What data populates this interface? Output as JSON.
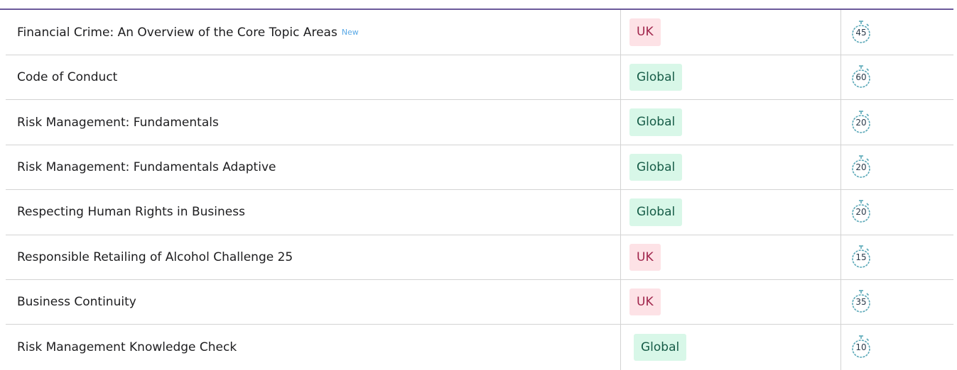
{
  "courses": [
    {
      "title": "Financial Crime: An Overview of the Core Topic Areas",
      "new_tag": "New",
      "region": "UK",
      "duration": "45"
    },
    {
      "title": "Code of Conduct",
      "new_tag": "",
      "region": "Global",
      "duration": "60"
    },
    {
      "title": "Risk Management: Fundamentals",
      "new_tag": "",
      "region": "Global",
      "duration": "20"
    },
    {
      "title": "Risk Management: Fundamentals Adaptive",
      "new_tag": "",
      "region": "Global",
      "duration": "20"
    },
    {
      "title": "Respecting Human Rights in Business",
      "new_tag": "",
      "region": "Global",
      "duration": "20"
    },
    {
      "title": "Responsible Retailing of Alcohol Challenge 25",
      "new_tag": "",
      "region": "UK",
      "duration": "15"
    },
    {
      "title": "Business Continuity",
      "new_tag": "",
      "region": "UK",
      "duration": "35"
    },
    {
      "title": "Risk Management Knowledge Check",
      "new_tag": "",
      "region": "Global",
      "duration": "10"
    }
  ],
  "colors": {
    "header_accent": "#6b5a9b",
    "uk_badge_bg": "#fde2e6",
    "uk_badge_text": "#a0264c",
    "global_badge_bg": "#d8f7e8",
    "global_badge_text": "#165c47",
    "new_tag": "#5aa9e6",
    "stopwatch_stroke": "#5aa8b8"
  },
  "icons": {
    "duration": "stopwatch-icon"
  }
}
